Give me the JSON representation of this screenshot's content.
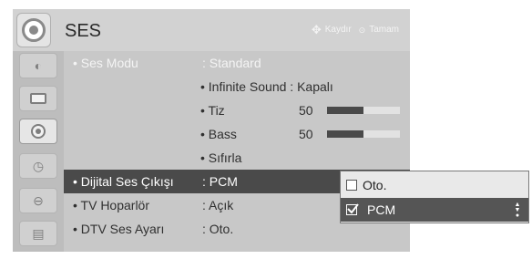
{
  "header": {
    "title": "SES",
    "hints": {
      "move_label": "Kaydır",
      "ok_label": "Tamam",
      "move_icon": "move-icon",
      "ok_icon": "ok-icon"
    }
  },
  "sidebar": {
    "items": [
      {
        "icon": "picture-icon",
        "selected": false
      },
      {
        "icon": "tv-icon",
        "selected": false
      },
      {
        "icon": "audio-icon",
        "selected": true
      },
      {
        "icon": "clock-icon",
        "selected": false
      },
      {
        "icon": "lock-icon",
        "selected": false
      },
      {
        "icon": "options-icon",
        "selected": false
      }
    ]
  },
  "menu": {
    "rows": [
      {
        "label": "• Ses Modu",
        "value": ": Standard",
        "dim": true
      },
      {
        "sub": "• Infinite Sound : Kapalı"
      },
      {
        "sub": "• Tiz",
        "num": "50",
        "level": 0.5
      },
      {
        "sub": "• Bass",
        "num": "50",
        "level": 0.5
      },
      {
        "sub": "• Sıfırla"
      },
      {
        "label": "• Dijital Ses Çıkışı",
        "value": ": PCM",
        "highlight": true
      },
      {
        "label": "• TV Hoparlör",
        "value": ": Açık"
      },
      {
        "label": "• DTV Ses Ayarı",
        "value": ": Oto."
      }
    ]
  },
  "popup": {
    "options": [
      {
        "label": "Oto.",
        "checked": false
      },
      {
        "label": "PCM",
        "checked": true
      }
    ],
    "arrows_icon": "up-down-arrows-icon"
  },
  "colors": {
    "highlight": "#4a4a4a",
    "panel": "#c8c8c8",
    "popup_selected": "#555555"
  }
}
